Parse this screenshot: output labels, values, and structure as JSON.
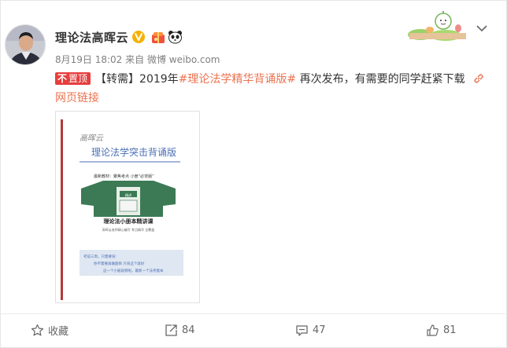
{
  "post": {
    "author_name": "理论法高晖云",
    "time": "8月19日 18:02",
    "source": "来自 微博 weibo.com",
    "pin_label": "置顶",
    "body_prefix": "【转需】2019年",
    "hashtag": "#理论法学精华背诵版#",
    "body_suffix": " 再次发布，有需要的同学赶紧下载",
    "link_label": "网页链接"
  },
  "attachment": {
    "handwritten": "高晖云",
    "title": "理论法学突击背诵版",
    "subtitle": "最新教材：聚焦考点  小册“必背版”",
    "book_title": "理论法小册本精讲课",
    "book_sub": "高晖云老师精心编写 考点精华 全覆盖",
    "note_lines": [
      "考前三周，只需要背：",
      "你不需要再做题目 只背这个就好",
      "这一个小册就够啦，最新一个法考版本"
    ]
  },
  "footer": {
    "favorite_label": "收藏",
    "repost_count": "84",
    "comment_count": "47",
    "like_count": "81"
  },
  "colors": {
    "accent": "#eb7350",
    "pin_red": "#e63e3e",
    "book_green": "#3c7a55"
  }
}
